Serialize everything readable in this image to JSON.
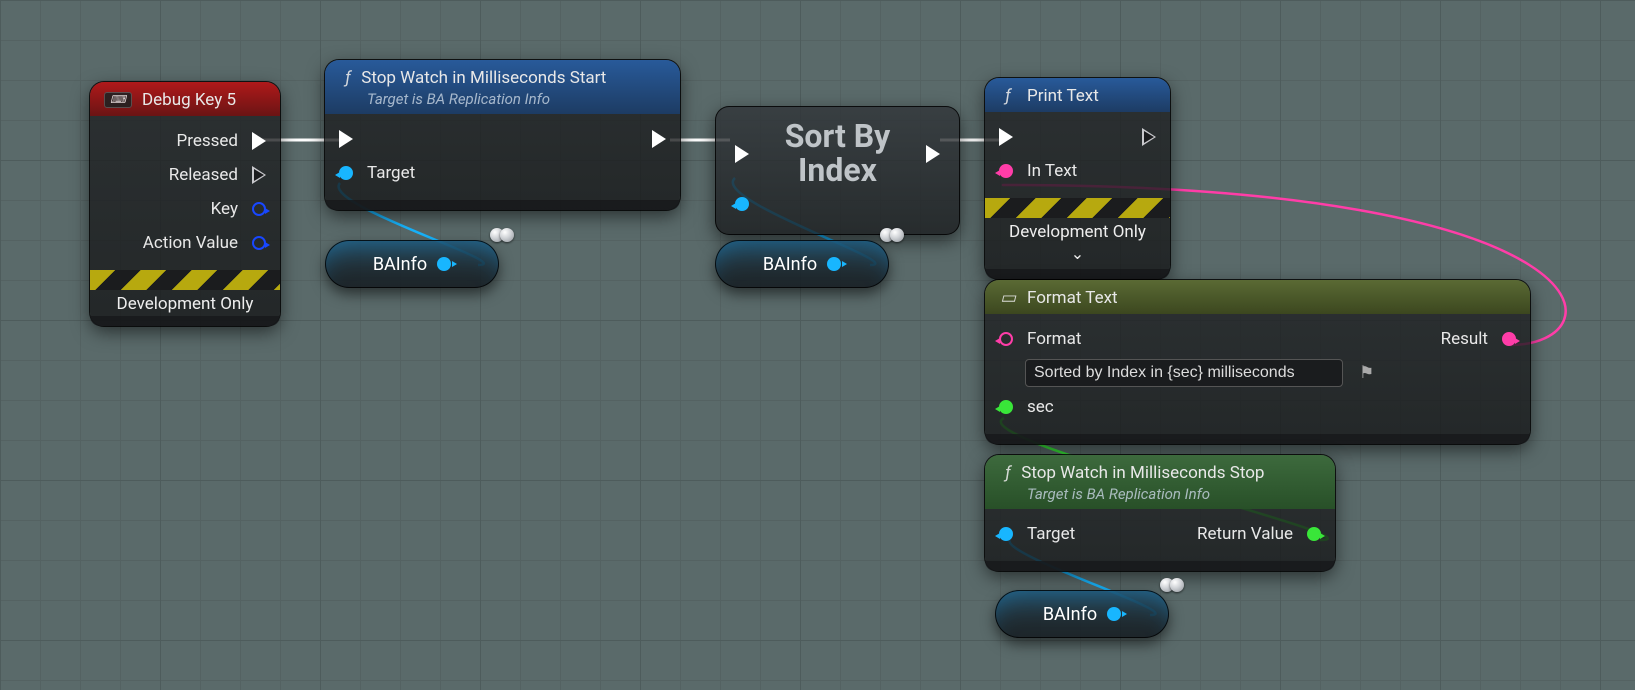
{
  "nodes": {
    "debugKey": {
      "title": "Debug Key 5",
      "pins": {
        "pressed": "Pressed",
        "released": "Released",
        "key": "Key",
        "action": "Action Value"
      },
      "devOnly": "Development Only"
    },
    "swStart": {
      "title": "Stop Watch in Milliseconds Start",
      "subtitle": "Target is BA Replication Info",
      "pins": {
        "target": "Target"
      }
    },
    "sort": {
      "line1": "Sort By",
      "line2": "Index"
    },
    "printText": {
      "title": "Print Text",
      "pins": {
        "inText": "In Text"
      },
      "devOnly": "Development Only"
    },
    "formatText": {
      "title": "Format Text",
      "pins": {
        "format": "Format",
        "sec": "sec",
        "result": "Result"
      },
      "value": "Sorted by Index in {sec} milliseconds"
    },
    "swStop": {
      "title": "Stop Watch in Milliseconds Stop",
      "subtitle": "Target is BA Replication Info",
      "pins": {
        "target": "Target",
        "return": "Return Value"
      }
    },
    "bainfo": "BAInfo"
  },
  "colors": {
    "object": "#18b6ff",
    "struct": "#1847ff",
    "text": "#ff3da8",
    "wild": "#39e639"
  }
}
